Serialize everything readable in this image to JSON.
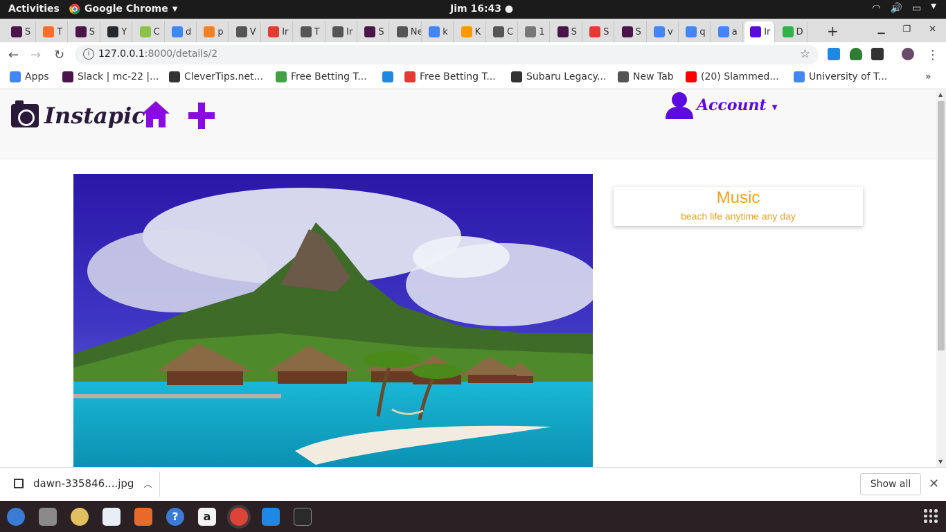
{
  "system_bar": {
    "activities": "Activities",
    "app_name": "Google Chrome",
    "clock": "Jim 16:43"
  },
  "tabs": [
    {
      "label": "S",
      "color": "#4a154b"
    },
    {
      "label": "T",
      "color": "#fc6d26"
    },
    {
      "label": "S",
      "color": "#4a154b"
    },
    {
      "label": "Y",
      "color": "#24292e"
    },
    {
      "label": "C",
      "color": "#8bc34a"
    },
    {
      "label": "d",
      "color": "#4285f4"
    },
    {
      "label": "p",
      "color": "#f48024"
    },
    {
      "label": "V",
      "color": "#555555"
    },
    {
      "label": "Ir",
      "color": "#e53935"
    },
    {
      "label": "T",
      "color": "#555555"
    },
    {
      "label": "Ir",
      "color": "#555555"
    },
    {
      "label": "S",
      "color": "#4a154b"
    },
    {
      "label": "New",
      "color": "#555555"
    },
    {
      "label": "k",
      "color": "#4285f4"
    },
    {
      "label": "K",
      "color": "#ff9800"
    },
    {
      "label": "C",
      "color": "#555555"
    },
    {
      "label": "1",
      "color": "#777777"
    },
    {
      "label": "S",
      "color": "#4a154b"
    },
    {
      "label": "S",
      "color": "#e53935"
    },
    {
      "label": "S",
      "color": "#4a154b"
    },
    {
      "label": "v",
      "color": "#4285f4"
    },
    {
      "label": "q",
      "color": "#4285f4"
    },
    {
      "label": "a",
      "color": "#4285f4"
    },
    {
      "label": "Ir",
      "color": "#5b0bde"
    },
    {
      "label": "D",
      "color": "#2fb24c"
    }
  ],
  "address_bar": {
    "url_host": "127.0.0.1",
    "url_path": ":8000/details/2"
  },
  "bookmarks": [
    {
      "label": "Apps",
      "color": "#4285f4"
    },
    {
      "label": "Slack | mc-22 |...",
      "color": "#4a154b"
    },
    {
      "label": "CleverTips.net...",
      "color": "#333333"
    },
    {
      "label": "Free Betting T...",
      "color": "#43a047"
    },
    {
      "label": "",
      "color": "#1e88e5"
    },
    {
      "label": "Free Betting T...",
      "color": "#e53935"
    },
    {
      "label": "Subaru Legacy...",
      "color": "#333333"
    },
    {
      "label": "New Tab",
      "color": "#555555"
    },
    {
      "label": "(20) Slammed...",
      "color": "#ff0000"
    },
    {
      "label": "University of T...",
      "color": "#4285f4"
    }
  ],
  "page": {
    "brand": "Instapic",
    "account_label": "Account",
    "brand_color": "#2a1a3a",
    "accent_color": "#8a0be0",
    "account_color": "#5b0bde",
    "card": {
      "title": "Music",
      "caption": "beach life anytime any day",
      "text_color": "#f0a01c"
    }
  },
  "downloads": {
    "filename": "dawn-335846....jpg",
    "show_all": "Show all"
  }
}
